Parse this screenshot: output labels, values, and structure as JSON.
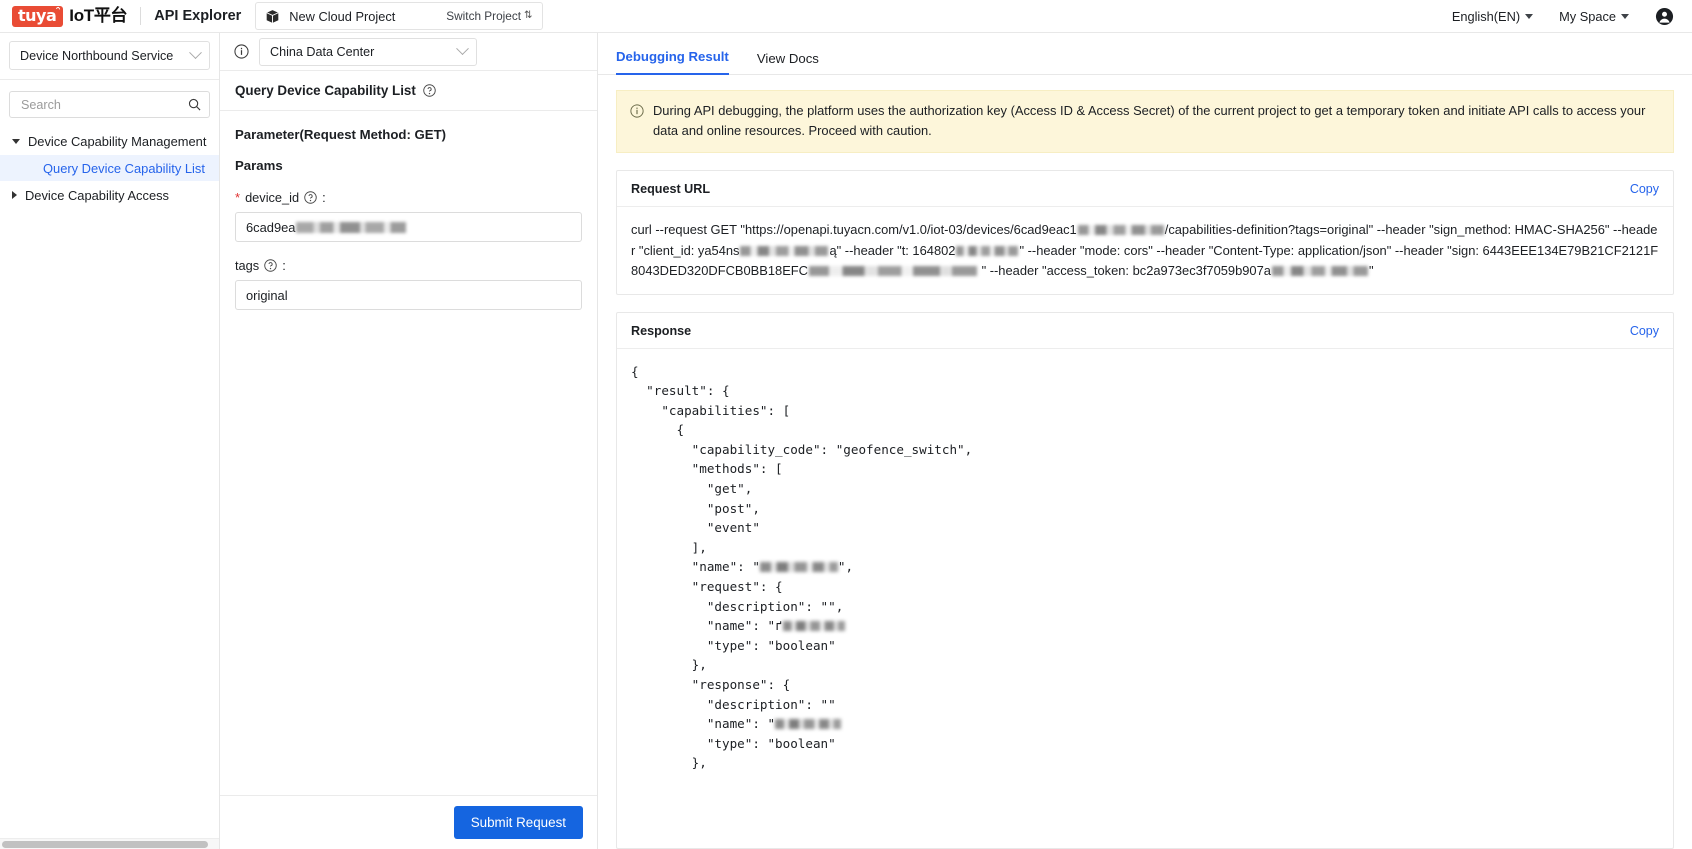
{
  "header": {
    "logo_badge": "tuya",
    "logo_text": "IoT平台",
    "title": "API Explorer",
    "project_icon": "cube-icon",
    "project_name": "New Cloud Project",
    "switch_project": "Switch Project",
    "switch_glyph": "⇅",
    "language": "English(EN)",
    "space": "My Space",
    "avatar_icon": "user-avatar-icon"
  },
  "sidebar": {
    "service_select": "Device Northbound Service",
    "search_placeholder": "Search",
    "search_value": "",
    "search_icon": "search-icon",
    "tree": [
      {
        "label": "Device Capability Management",
        "expanded": true,
        "type": "group"
      },
      {
        "label": "Query Device Capability List",
        "active": true,
        "type": "leaf"
      },
      {
        "label": "Device Capability Access",
        "expanded": false,
        "type": "group"
      }
    ]
  },
  "middle": {
    "info_icon": "info-circle-icon",
    "data_center": "China Data Center",
    "api_title": "Query Device Capability List",
    "api_help_icon": "question-circle-icon",
    "parameter_method": "Parameter(Request Method: GET)",
    "params_heading": "Params",
    "fields": [
      {
        "name": "device_id",
        "required": true,
        "label": "device_id",
        "colon": ":",
        "value_visible": "6cad9ea",
        "value_masked": true,
        "help_icon": "question-circle-icon"
      },
      {
        "name": "tags",
        "required": false,
        "label": "tags",
        "colon": ":",
        "value_visible": "original",
        "value_masked": false,
        "help_icon": "question-circle-icon"
      }
    ],
    "submit_label": "Submit Request"
  },
  "right": {
    "tabs": [
      {
        "label": "Debugging Result",
        "active": true
      },
      {
        "label": "View Docs",
        "active": false
      }
    ],
    "notice": {
      "icon": "info-circle-icon",
      "text": "During API debugging, the platform uses the authorization key (Access ID & Access Secret) of the current project to get a temporary token and initiate API calls to access your data and online resources. Proceed with caution.",
      "bg": "#fdf6da",
      "border": "#f7eec3"
    },
    "request_card": {
      "title": "Request URL",
      "copy_label": "Copy",
      "curl_parts": [
        "curl --request GET \"https://openapi.tuyacn.com/v1.0/iot-03/devices/6cad9eac1",
        "[MASKED]",
        "/capabilities-definition?tags=original\" --header \"sign_method: HMAC-SHA256\" --header \"client_id: ya54ns",
        "[MASKED]",
        "ą\" --header \"t: 164802",
        "[MASKED]",
        "\" --header \"mode: cors\" --header \"Content-Type: application/json\" --header \"sign: 6443EEE134E79B21CF2121F8043DED320DFCB0BB18EFC",
        "[MASKED]",
        " \" --header \"access_token: bc2a973ec3f7059b907a",
        "[MASKED]",
        "\""
      ]
    },
    "response_card": {
      "title": "Response",
      "copy_label": "Copy",
      "json_lines": [
        {
          "text": "{"
        },
        {
          "text": "  \"result\": {"
        },
        {
          "text": "    \"capabilities\": ["
        },
        {
          "text": "      {"
        },
        {
          "text": "        \"capability_code\": \"geofence_switch\","
        },
        {
          "text": "        \"methods\": ["
        },
        {
          "text": "          \"get\","
        },
        {
          "text": "          \"post\","
        },
        {
          "text": "          \"event\""
        },
        {
          "text": "        ],"
        },
        {
          "text": "        \"name\": \"",
          "mask": 78,
          "after": "\","
        },
        {
          "text": "        \"request\": {"
        },
        {
          "text": "          \"description\": \"\","
        },
        {
          "text": "          \"name\": \"ґ",
          "mask": 62,
          "after": ""
        },
        {
          "text": "          \"type\": \"boolean\""
        },
        {
          "text": "        },"
        },
        {
          "text": "        \"response\": {"
        },
        {
          "text": "          \"description\": \"\""
        },
        {
          "text": "          \"name\": \"",
          "mask": 66,
          "after": ""
        },
        {
          "text": "          \"type\": \"boolean\""
        },
        {
          "text": "        },"
        }
      ]
    }
  },
  "colors": {
    "accent": "#2664eb",
    "submit_blue": "#1565e0",
    "brand_red": "#e94c35",
    "notice_bg": "#fdf6da"
  }
}
